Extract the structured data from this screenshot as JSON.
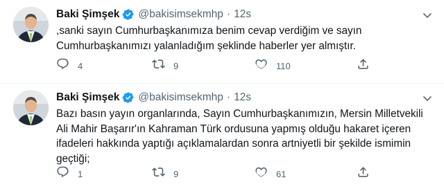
{
  "tweets": [
    {
      "author_name": "Baki Şimşek",
      "handle": "@bakisimsekmhp",
      "separator": "·",
      "time": "12s",
      "text": ",sanki sayın Cumhurbaşkanımıza benim cevap verdiğim ve sayın Cumhurbaşkanımızı yalanladığım şeklinde haberler yer almıştır.",
      "replies": "4",
      "retweets": "9",
      "likes": "110"
    },
    {
      "author_name": "Baki Şimşek",
      "handle": "@bakisimsekmhp",
      "separator": "·",
      "time": "12s",
      "text": "Bazı basın yayın organlarında, Sayın Cumhurbaşkanımızın, Mersin Milletvekili Ali Mahir Başarır'ın Kahraman Türk ordusuna yapmış olduğu hakaret içeren ifadeleri hakkında yaptığı açıklamalardan sonra artniyetli bir şekilde ismimin geçtiği;",
      "replies": "1",
      "retweets": "9",
      "likes": "61"
    }
  ],
  "icons": {
    "verified": "verified-badge-icon",
    "more": "chevron-down-icon",
    "reply": "reply-icon",
    "retweet": "retweet-icon",
    "like": "heart-icon",
    "share": "share-icon"
  },
  "colors": {
    "verified_blue": "#1d9bf0",
    "text_primary": "#0f1419",
    "text_secondary": "#536471",
    "divider": "#eff3f4"
  }
}
